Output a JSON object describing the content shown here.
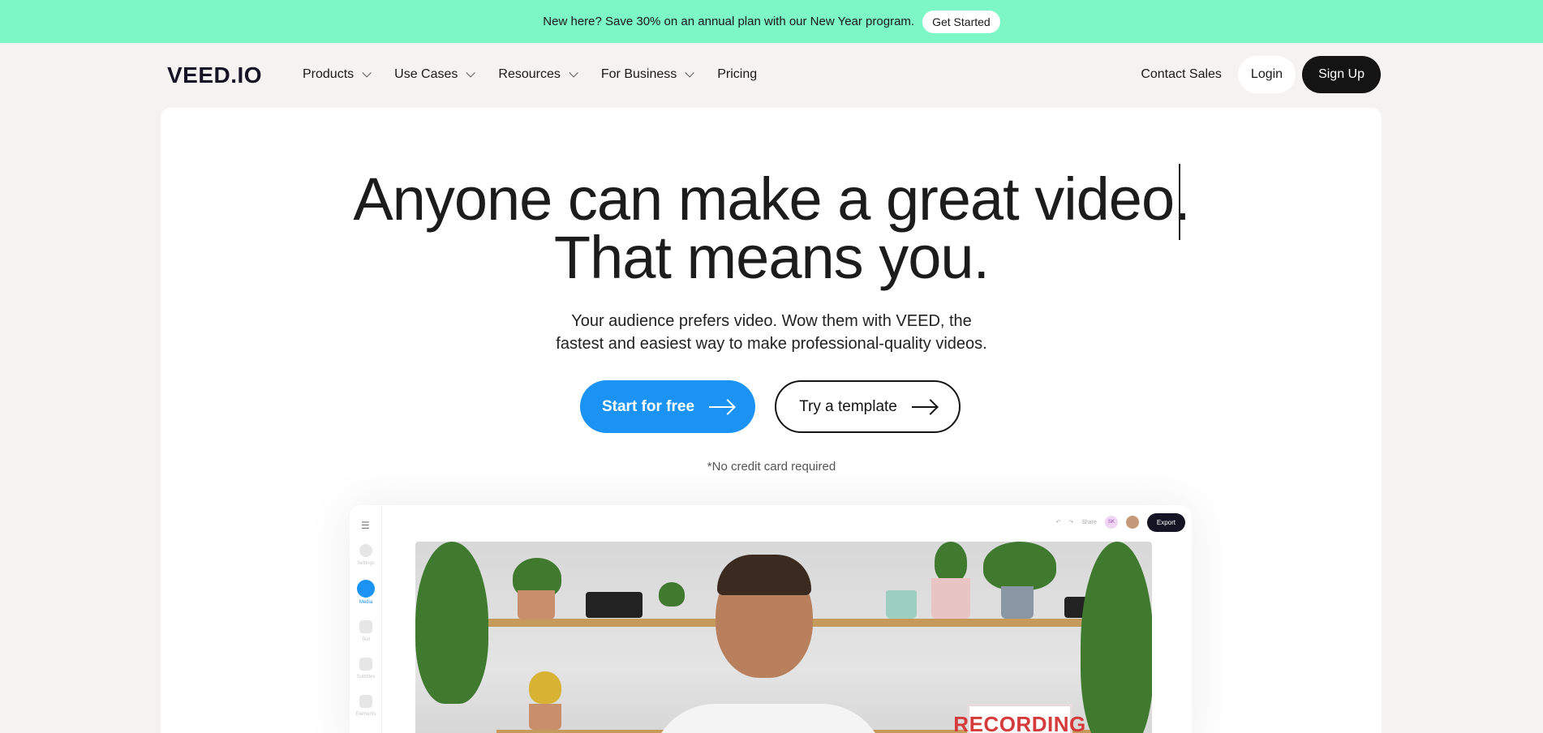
{
  "promo": {
    "text": "New here? Save 30% on an annual plan with our New Year program.",
    "button": "Get Started"
  },
  "nav": {
    "logo": "VEED.IO",
    "items": [
      {
        "label": "Products"
      },
      {
        "label": "Use Cases"
      },
      {
        "label": "Resources"
      },
      {
        "label": "For Business"
      },
      {
        "label": "Pricing"
      }
    ],
    "contact": "Contact Sales",
    "login": "Login",
    "signup": "Sign Up"
  },
  "hero": {
    "line1": "Anyone can make a great video.",
    "line2": "That means you.",
    "sub1": "Your audience prefers video. Wow them with VEED, the",
    "sub2": "fastest and easiest way to make professional-quality videos.",
    "cta_primary": "Start for free",
    "cta_secondary": "Try a template",
    "note": "*No credit card required"
  },
  "editor": {
    "sidebar": [
      {
        "label": "Settings"
      },
      {
        "label": "Media"
      },
      {
        "label": "Text"
      },
      {
        "label": "Subtitles"
      },
      {
        "label": "Elements"
      }
    ],
    "share": "Share",
    "avatar_initials": "SK",
    "export": "Export",
    "overlay_text": "RECORDING"
  },
  "colors": {
    "promo_bg": "#7df7c6",
    "primary": "#1a93f5",
    "dark": "#141414"
  }
}
